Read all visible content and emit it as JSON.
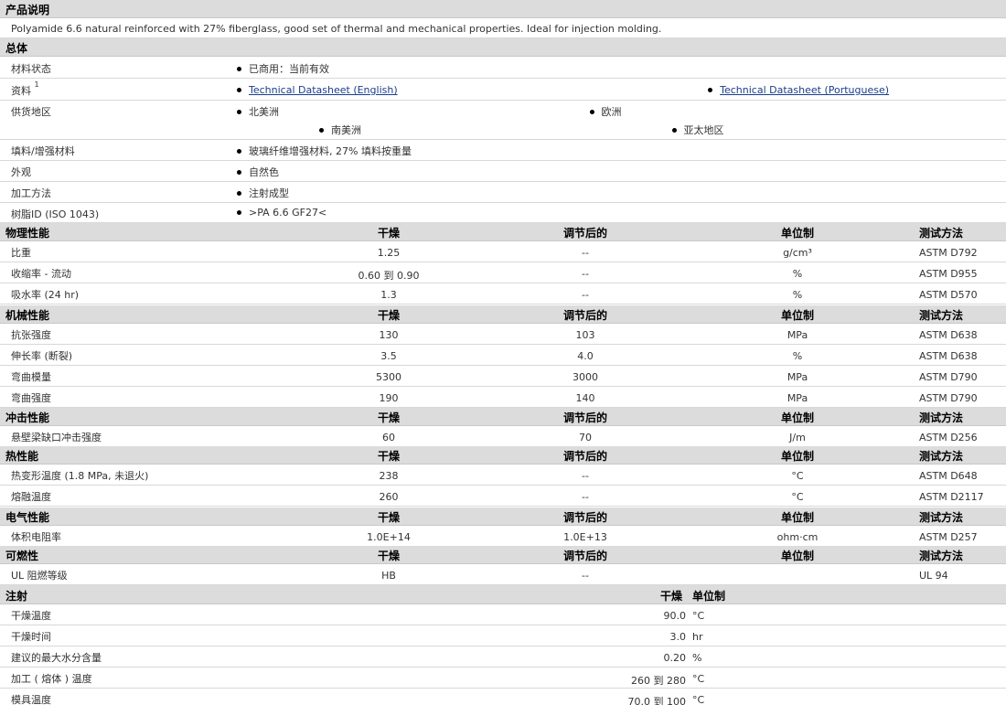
{
  "description": {
    "header": "产品说明",
    "text": "Polyamide 6.6 natural reinforced with 27% fiberglass, good set of thermal and mechanical properties. Ideal for injection molding."
  },
  "general": {
    "header": "总体",
    "material_status": {
      "label": "材料状态",
      "value": "已商用：当前有效"
    },
    "literature": {
      "label": "资料",
      "sup": "1",
      "link1": "Technical Datasheet (English)",
      "link2": "Technical Datasheet (Portuguese)"
    },
    "availability": {
      "label": "供货地区",
      "v1": "北美洲",
      "v2": "欧洲",
      "v3": "南美洲",
      "v4": "亚太地区"
    },
    "filler": {
      "label": "填料/增强材料",
      "value": "玻璃纤维增强材料, 27% 填料按重量"
    },
    "appearance": {
      "label": "外观",
      "value": "自然色"
    },
    "processing": {
      "label": "加工方法",
      "value": "注射成型"
    },
    "resin_id": {
      "label": "树脂ID (ISO 1043)",
      "value": ">PA 6.6 GF27<"
    }
  },
  "col_headers": {
    "dry": "干燥",
    "conditioned": "调节后的",
    "unit": "单位制",
    "method": "测试方法"
  },
  "physical": {
    "header": "物理性能",
    "rows": [
      {
        "label": "比重",
        "dry": "1.25",
        "cond": "--",
        "unit": "g/cm³",
        "method": "ASTM D792"
      },
      {
        "label": "收缩率 - 流动",
        "dry": "0.60 到  0.90",
        "cond": "--",
        "unit": "%",
        "method": "ASTM D955"
      },
      {
        "label": "吸水率 (24 hr)",
        "dry": "1.3",
        "cond": "--",
        "unit": "%",
        "method": "ASTM D570"
      }
    ]
  },
  "mechanical": {
    "header": "机械性能",
    "rows": [
      {
        "label": "抗张强度",
        "dry": "130",
        "cond": "103",
        "unit": "MPa",
        "method": "ASTM D638"
      },
      {
        "label": "伸长率 (断裂)",
        "dry": "3.5",
        "cond": "4.0",
        "unit": "%",
        "method": "ASTM D638"
      },
      {
        "label": "弯曲模量",
        "dry": "5300",
        "cond": "3000",
        "unit": "MPa",
        "method": "ASTM D790"
      },
      {
        "label": "弯曲强度",
        "dry": "190",
        "cond": "140",
        "unit": "MPa",
        "method": "ASTM D790"
      }
    ]
  },
  "impact": {
    "header": "冲击性能",
    "rows": [
      {
        "label": "悬壁梁缺口冲击强度",
        "dry": "60",
        "cond": "70",
        "unit": "J/m",
        "method": "ASTM D256"
      }
    ]
  },
  "thermal": {
    "header": "热性能",
    "rows": [
      {
        "label": "热变形温度 (1.8 MPa, 未退火)",
        "dry": "238",
        "cond": "--",
        "unit": "°C",
        "method": "ASTM D648"
      },
      {
        "label": "熔融温度",
        "dry": "260",
        "cond": "--",
        "unit": "°C",
        "method": "ASTM D2117"
      }
    ]
  },
  "electrical": {
    "header": "电气性能",
    "rows": [
      {
        "label": "体积电阻率",
        "dry": "1.0E+14",
        "cond": "1.0E+13",
        "unit": "ohm·cm",
        "method": "ASTM D257"
      }
    ]
  },
  "flammability": {
    "header": "可燃性",
    "rows": [
      {
        "label": "UL 阻燃等级",
        "dry": "HB",
        "cond": "--",
        "unit": "",
        "method": "UL 94"
      }
    ]
  },
  "injection": {
    "header": "注射",
    "dry_header": "干燥",
    "unit_header": "单位制",
    "rows": [
      {
        "label": "干燥温度",
        "value": "90.0",
        "unit": "°C"
      },
      {
        "label": "干燥时间",
        "value": "3.0",
        "unit": "hr"
      },
      {
        "label": "建议的最大水分含量",
        "value": "0.20",
        "unit": "%"
      },
      {
        "label": "加工 ( 熔体 ) 温度",
        "value": "260 到  280",
        "unit": "°C"
      },
      {
        "label": "模具温度",
        "value": "70.0 到  100",
        "unit": "°C"
      }
    ]
  }
}
